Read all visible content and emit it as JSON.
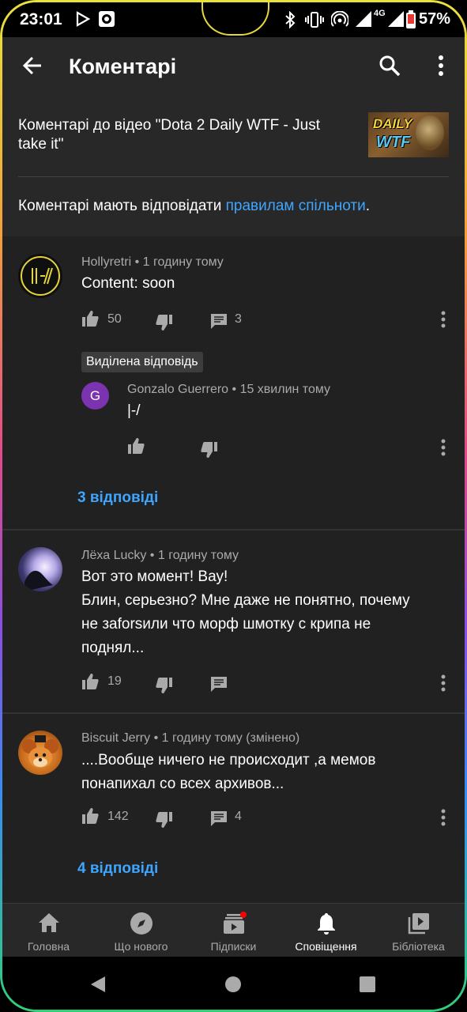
{
  "status_bar": {
    "time": "23:01",
    "battery": "57%",
    "network": "4G"
  },
  "app_bar": {
    "title": "Коментарі"
  },
  "header": {
    "video_title": "Коментарі до відео \"Dota 2 Daily WTF - Just take it\"",
    "thumbnail_text_1": "DAILY",
    "thumbnail_text_2": "WTF",
    "rules_prefix": "Коментарі мають відповідати ",
    "rules_link": "правилам спільноти",
    "rules_suffix": "."
  },
  "comments": [
    {
      "author": "Hollyretri",
      "time": "1 годину тому",
      "text": "Content: soon",
      "likes": "50",
      "replies_count": "3",
      "pinned_label": "Виділена відповідь",
      "pinned_reply": {
        "author": "Gonzalo Guerrero",
        "time": "15 хвилин тому",
        "text": "|-/",
        "avatar_letter": "G"
      },
      "view_replies": "3 відповіді"
    },
    {
      "author": "Лёха Lucky",
      "time": "1 годину тому",
      "text_line_1": "Вот это момент! Вау!",
      "text_line_2": "Блин, серьезно? Мне даже не понятно, почему",
      "text_line_3": "не заforsили что морф шмотку с крипа не",
      "text_line_4": "поднял...",
      "likes": "19"
    },
    {
      "author": "Biscuit Jerry",
      "time": "1 годину тому (змінено)",
      "text_line_1": "....Вообще ничего не происходит ,а мемов",
      "text_line_2": "понапихал со всех архивов...",
      "likes": "142",
      "replies_count": "4",
      "view_replies": "4 відповіді"
    }
  ],
  "bottom_nav": [
    {
      "label": "Головна",
      "icon": "home-icon"
    },
    {
      "label": "Що нового",
      "icon": "explore-icon"
    },
    {
      "label": "Підписки",
      "icon": "subscriptions-icon"
    },
    {
      "label": "Сповіщення",
      "icon": "bell-icon",
      "active": true
    },
    {
      "label": "Бібліотека",
      "icon": "library-icon"
    }
  ],
  "colors": {
    "accent_link": "#3ea6ff",
    "background": "#212121",
    "bar": "#282828",
    "badge": "#ff0000"
  }
}
